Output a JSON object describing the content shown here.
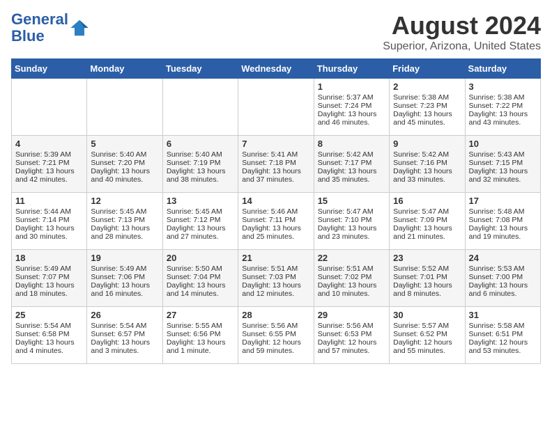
{
  "header": {
    "logo_line1": "General",
    "logo_line2": "Blue",
    "title": "August 2024",
    "subtitle": "Superior, Arizona, United States"
  },
  "days_of_week": [
    "Sunday",
    "Monday",
    "Tuesday",
    "Wednesday",
    "Thursday",
    "Friday",
    "Saturday"
  ],
  "weeks": [
    [
      {
        "day": "",
        "sunrise": "",
        "sunset": "",
        "daylight": ""
      },
      {
        "day": "",
        "sunrise": "",
        "sunset": "",
        "daylight": ""
      },
      {
        "day": "",
        "sunrise": "",
        "sunset": "",
        "daylight": ""
      },
      {
        "day": "",
        "sunrise": "",
        "sunset": "",
        "daylight": ""
      },
      {
        "day": "1",
        "sunrise": "Sunrise: 5:37 AM",
        "sunset": "Sunset: 7:24 PM",
        "daylight": "Daylight: 13 hours and 46 minutes."
      },
      {
        "day": "2",
        "sunrise": "Sunrise: 5:38 AM",
        "sunset": "Sunset: 7:23 PM",
        "daylight": "Daylight: 13 hours and 45 minutes."
      },
      {
        "day": "3",
        "sunrise": "Sunrise: 5:38 AM",
        "sunset": "Sunset: 7:22 PM",
        "daylight": "Daylight: 13 hours and 43 minutes."
      }
    ],
    [
      {
        "day": "4",
        "sunrise": "Sunrise: 5:39 AM",
        "sunset": "Sunset: 7:21 PM",
        "daylight": "Daylight: 13 hours and 42 minutes."
      },
      {
        "day": "5",
        "sunrise": "Sunrise: 5:40 AM",
        "sunset": "Sunset: 7:20 PM",
        "daylight": "Daylight: 13 hours and 40 minutes."
      },
      {
        "day": "6",
        "sunrise": "Sunrise: 5:40 AM",
        "sunset": "Sunset: 7:19 PM",
        "daylight": "Daylight: 13 hours and 38 minutes."
      },
      {
        "day": "7",
        "sunrise": "Sunrise: 5:41 AM",
        "sunset": "Sunset: 7:18 PM",
        "daylight": "Daylight: 13 hours and 37 minutes."
      },
      {
        "day": "8",
        "sunrise": "Sunrise: 5:42 AM",
        "sunset": "Sunset: 7:17 PM",
        "daylight": "Daylight: 13 hours and 35 minutes."
      },
      {
        "day": "9",
        "sunrise": "Sunrise: 5:42 AM",
        "sunset": "Sunset: 7:16 PM",
        "daylight": "Daylight: 13 hours and 33 minutes."
      },
      {
        "day": "10",
        "sunrise": "Sunrise: 5:43 AM",
        "sunset": "Sunset: 7:15 PM",
        "daylight": "Daylight: 13 hours and 32 minutes."
      }
    ],
    [
      {
        "day": "11",
        "sunrise": "Sunrise: 5:44 AM",
        "sunset": "Sunset: 7:14 PM",
        "daylight": "Daylight: 13 hours and 30 minutes."
      },
      {
        "day": "12",
        "sunrise": "Sunrise: 5:45 AM",
        "sunset": "Sunset: 7:13 PM",
        "daylight": "Daylight: 13 hours and 28 minutes."
      },
      {
        "day": "13",
        "sunrise": "Sunrise: 5:45 AM",
        "sunset": "Sunset: 7:12 PM",
        "daylight": "Daylight: 13 hours and 27 minutes."
      },
      {
        "day": "14",
        "sunrise": "Sunrise: 5:46 AM",
        "sunset": "Sunset: 7:11 PM",
        "daylight": "Daylight: 13 hours and 25 minutes."
      },
      {
        "day": "15",
        "sunrise": "Sunrise: 5:47 AM",
        "sunset": "Sunset: 7:10 PM",
        "daylight": "Daylight: 13 hours and 23 minutes."
      },
      {
        "day": "16",
        "sunrise": "Sunrise: 5:47 AM",
        "sunset": "Sunset: 7:09 PM",
        "daylight": "Daylight: 13 hours and 21 minutes."
      },
      {
        "day": "17",
        "sunrise": "Sunrise: 5:48 AM",
        "sunset": "Sunset: 7:08 PM",
        "daylight": "Daylight: 13 hours and 19 minutes."
      }
    ],
    [
      {
        "day": "18",
        "sunrise": "Sunrise: 5:49 AM",
        "sunset": "Sunset: 7:07 PM",
        "daylight": "Daylight: 13 hours and 18 minutes."
      },
      {
        "day": "19",
        "sunrise": "Sunrise: 5:49 AM",
        "sunset": "Sunset: 7:06 PM",
        "daylight": "Daylight: 13 hours and 16 minutes."
      },
      {
        "day": "20",
        "sunrise": "Sunrise: 5:50 AM",
        "sunset": "Sunset: 7:04 PM",
        "daylight": "Daylight: 13 hours and 14 minutes."
      },
      {
        "day": "21",
        "sunrise": "Sunrise: 5:51 AM",
        "sunset": "Sunset: 7:03 PM",
        "daylight": "Daylight: 13 hours and 12 minutes."
      },
      {
        "day": "22",
        "sunrise": "Sunrise: 5:51 AM",
        "sunset": "Sunset: 7:02 PM",
        "daylight": "Daylight: 13 hours and 10 minutes."
      },
      {
        "day": "23",
        "sunrise": "Sunrise: 5:52 AM",
        "sunset": "Sunset: 7:01 PM",
        "daylight": "Daylight: 13 hours and 8 minutes."
      },
      {
        "day": "24",
        "sunrise": "Sunrise: 5:53 AM",
        "sunset": "Sunset: 7:00 PM",
        "daylight": "Daylight: 13 hours and 6 minutes."
      }
    ],
    [
      {
        "day": "25",
        "sunrise": "Sunrise: 5:54 AM",
        "sunset": "Sunset: 6:58 PM",
        "daylight": "Daylight: 13 hours and 4 minutes."
      },
      {
        "day": "26",
        "sunrise": "Sunrise: 5:54 AM",
        "sunset": "Sunset: 6:57 PM",
        "daylight": "Daylight: 13 hours and 3 minutes."
      },
      {
        "day": "27",
        "sunrise": "Sunrise: 5:55 AM",
        "sunset": "Sunset: 6:56 PM",
        "daylight": "Daylight: 13 hours and 1 minute."
      },
      {
        "day": "28",
        "sunrise": "Sunrise: 5:56 AM",
        "sunset": "Sunset: 6:55 PM",
        "daylight": "Daylight: 12 hours and 59 minutes."
      },
      {
        "day": "29",
        "sunrise": "Sunrise: 5:56 AM",
        "sunset": "Sunset: 6:53 PM",
        "daylight": "Daylight: 12 hours and 57 minutes."
      },
      {
        "day": "30",
        "sunrise": "Sunrise: 5:57 AM",
        "sunset": "Sunset: 6:52 PM",
        "daylight": "Daylight: 12 hours and 55 minutes."
      },
      {
        "day": "31",
        "sunrise": "Sunrise: 5:58 AM",
        "sunset": "Sunset: 6:51 PM",
        "daylight": "Daylight: 12 hours and 53 minutes."
      }
    ]
  ]
}
